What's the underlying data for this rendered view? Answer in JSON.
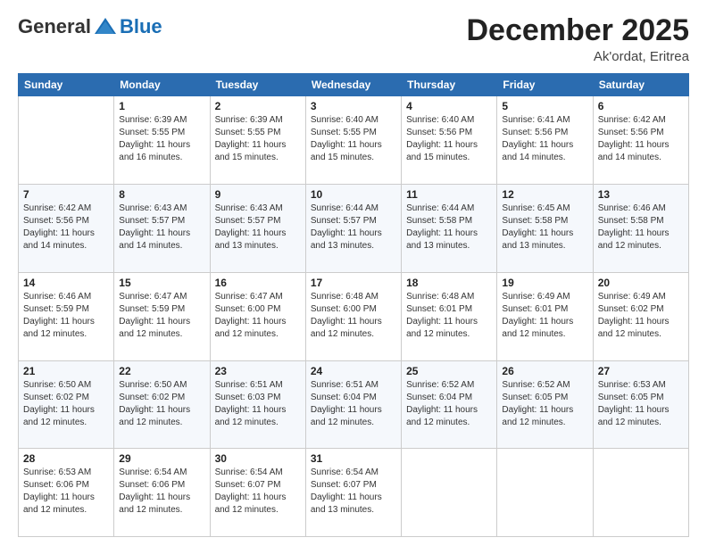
{
  "logo": {
    "general": "General",
    "blue": "Blue"
  },
  "title": {
    "month": "December 2025",
    "location": "Ak'ordat, Eritrea"
  },
  "headers": [
    "Sunday",
    "Monday",
    "Tuesday",
    "Wednesday",
    "Thursday",
    "Friday",
    "Saturday"
  ],
  "weeks": [
    [
      {
        "day": "",
        "info": ""
      },
      {
        "day": "1",
        "info": "Sunrise: 6:39 AM\nSunset: 5:55 PM\nDaylight: 11 hours\nand 16 minutes."
      },
      {
        "day": "2",
        "info": "Sunrise: 6:39 AM\nSunset: 5:55 PM\nDaylight: 11 hours\nand 15 minutes."
      },
      {
        "day": "3",
        "info": "Sunrise: 6:40 AM\nSunset: 5:55 PM\nDaylight: 11 hours\nand 15 minutes."
      },
      {
        "day": "4",
        "info": "Sunrise: 6:40 AM\nSunset: 5:56 PM\nDaylight: 11 hours\nand 15 minutes."
      },
      {
        "day": "5",
        "info": "Sunrise: 6:41 AM\nSunset: 5:56 PM\nDaylight: 11 hours\nand 14 minutes."
      },
      {
        "day": "6",
        "info": "Sunrise: 6:42 AM\nSunset: 5:56 PM\nDaylight: 11 hours\nand 14 minutes."
      }
    ],
    [
      {
        "day": "7",
        "info": "Sunrise: 6:42 AM\nSunset: 5:56 PM\nDaylight: 11 hours\nand 14 minutes."
      },
      {
        "day": "8",
        "info": "Sunrise: 6:43 AM\nSunset: 5:57 PM\nDaylight: 11 hours\nand 14 minutes."
      },
      {
        "day": "9",
        "info": "Sunrise: 6:43 AM\nSunset: 5:57 PM\nDaylight: 11 hours\nand 13 minutes."
      },
      {
        "day": "10",
        "info": "Sunrise: 6:44 AM\nSunset: 5:57 PM\nDaylight: 11 hours\nand 13 minutes."
      },
      {
        "day": "11",
        "info": "Sunrise: 6:44 AM\nSunset: 5:58 PM\nDaylight: 11 hours\nand 13 minutes."
      },
      {
        "day": "12",
        "info": "Sunrise: 6:45 AM\nSunset: 5:58 PM\nDaylight: 11 hours\nand 13 minutes."
      },
      {
        "day": "13",
        "info": "Sunrise: 6:46 AM\nSunset: 5:58 PM\nDaylight: 11 hours\nand 12 minutes."
      }
    ],
    [
      {
        "day": "14",
        "info": "Sunrise: 6:46 AM\nSunset: 5:59 PM\nDaylight: 11 hours\nand 12 minutes."
      },
      {
        "day": "15",
        "info": "Sunrise: 6:47 AM\nSunset: 5:59 PM\nDaylight: 11 hours\nand 12 minutes."
      },
      {
        "day": "16",
        "info": "Sunrise: 6:47 AM\nSunset: 6:00 PM\nDaylight: 11 hours\nand 12 minutes."
      },
      {
        "day": "17",
        "info": "Sunrise: 6:48 AM\nSunset: 6:00 PM\nDaylight: 11 hours\nand 12 minutes."
      },
      {
        "day": "18",
        "info": "Sunrise: 6:48 AM\nSunset: 6:01 PM\nDaylight: 11 hours\nand 12 minutes."
      },
      {
        "day": "19",
        "info": "Sunrise: 6:49 AM\nSunset: 6:01 PM\nDaylight: 11 hours\nand 12 minutes."
      },
      {
        "day": "20",
        "info": "Sunrise: 6:49 AM\nSunset: 6:02 PM\nDaylight: 11 hours\nand 12 minutes."
      }
    ],
    [
      {
        "day": "21",
        "info": "Sunrise: 6:50 AM\nSunset: 6:02 PM\nDaylight: 11 hours\nand 12 minutes."
      },
      {
        "day": "22",
        "info": "Sunrise: 6:50 AM\nSunset: 6:02 PM\nDaylight: 11 hours\nand 12 minutes."
      },
      {
        "day": "23",
        "info": "Sunrise: 6:51 AM\nSunset: 6:03 PM\nDaylight: 11 hours\nand 12 minutes."
      },
      {
        "day": "24",
        "info": "Sunrise: 6:51 AM\nSunset: 6:04 PM\nDaylight: 11 hours\nand 12 minutes."
      },
      {
        "day": "25",
        "info": "Sunrise: 6:52 AM\nSunset: 6:04 PM\nDaylight: 11 hours\nand 12 minutes."
      },
      {
        "day": "26",
        "info": "Sunrise: 6:52 AM\nSunset: 6:05 PM\nDaylight: 11 hours\nand 12 minutes."
      },
      {
        "day": "27",
        "info": "Sunrise: 6:53 AM\nSunset: 6:05 PM\nDaylight: 11 hours\nand 12 minutes."
      }
    ],
    [
      {
        "day": "28",
        "info": "Sunrise: 6:53 AM\nSunset: 6:06 PM\nDaylight: 11 hours\nand 12 minutes."
      },
      {
        "day": "29",
        "info": "Sunrise: 6:54 AM\nSunset: 6:06 PM\nDaylight: 11 hours\nand 12 minutes."
      },
      {
        "day": "30",
        "info": "Sunrise: 6:54 AM\nSunset: 6:07 PM\nDaylight: 11 hours\nand 12 minutes."
      },
      {
        "day": "31",
        "info": "Sunrise: 6:54 AM\nSunset: 6:07 PM\nDaylight: 11 hours\nand 13 minutes."
      },
      {
        "day": "",
        "info": ""
      },
      {
        "day": "",
        "info": ""
      },
      {
        "day": "",
        "info": ""
      }
    ]
  ]
}
